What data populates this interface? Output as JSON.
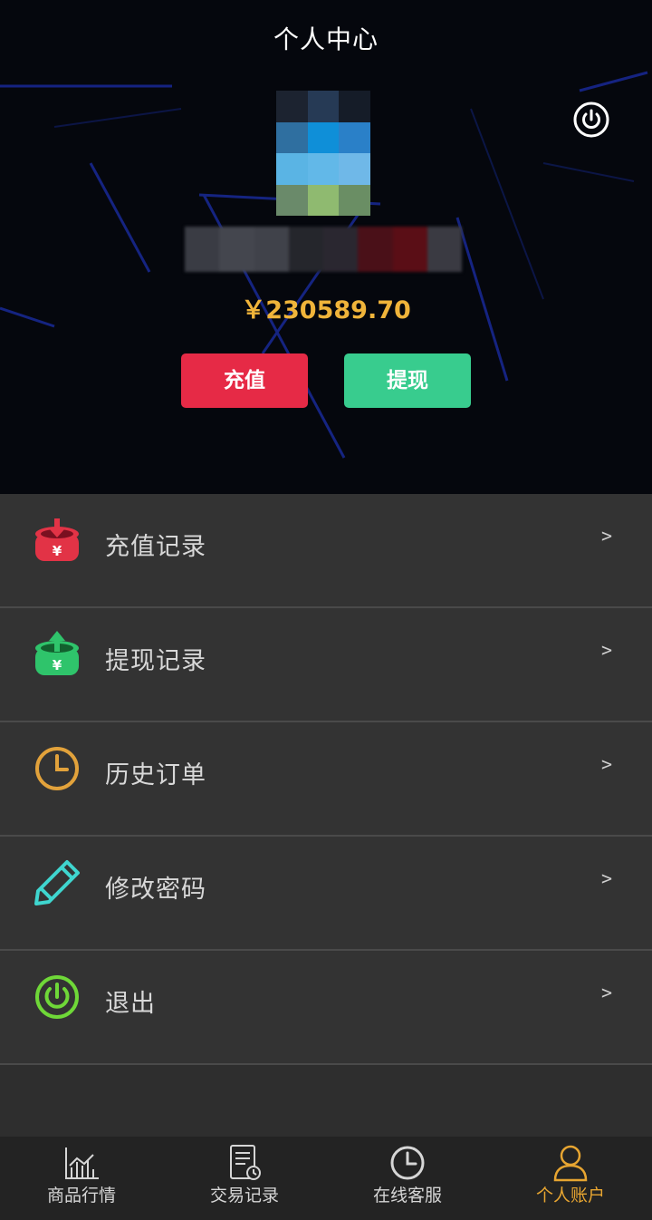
{
  "header": {
    "title": "个人中心",
    "balance": "￥230589.70",
    "recharge_label": "充值",
    "withdraw_label": "提现"
  },
  "menu": {
    "items": [
      {
        "label": "充值记录",
        "icon": "recharge-record-icon",
        "color": "#e23346"
      },
      {
        "label": "提现记录",
        "icon": "withdraw-record-icon",
        "color": "#2fc46b"
      },
      {
        "label": "历史订单",
        "icon": "clock-icon",
        "color": "#e2a23b"
      },
      {
        "label": "修改密码",
        "icon": "pencil-icon",
        "color": "#3fd6cf"
      },
      {
        "label": "退出",
        "icon": "power-icon",
        "color": "#6fd838"
      }
    ],
    "arrow": ">"
  },
  "tabbar": {
    "items": [
      {
        "label": "商品行情",
        "icon": "chart-icon"
      },
      {
        "label": "交易记录",
        "icon": "document-icon"
      },
      {
        "label": "在线客服",
        "icon": "clock-icon"
      },
      {
        "label": "个人账户",
        "icon": "person-icon",
        "active": true
      }
    ]
  },
  "colors": {
    "accent": "#e7a531",
    "recharge": "#e62a46",
    "withdraw": "#38cc8e",
    "menu_bg": "#333333"
  }
}
